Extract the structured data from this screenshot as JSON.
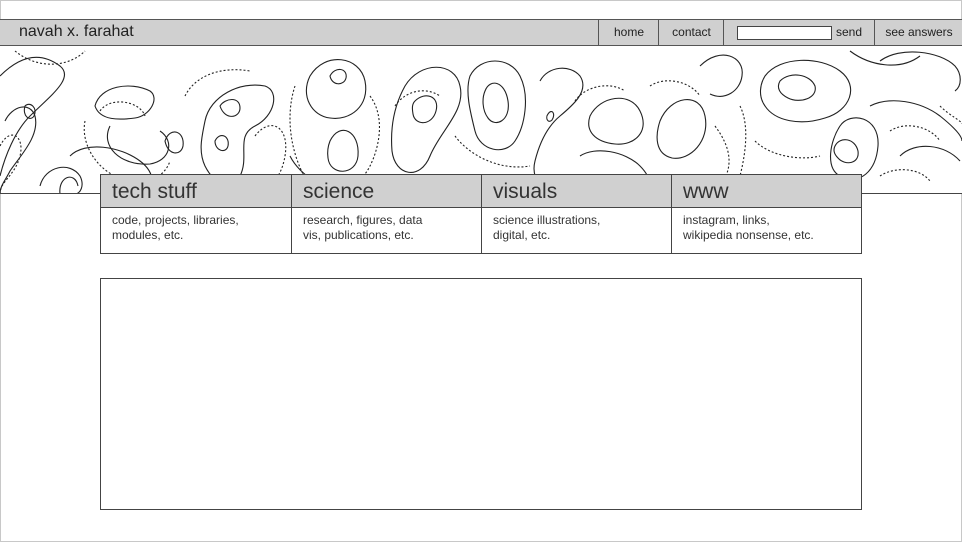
{
  "header": {
    "site_title": "navah x. farahat",
    "nav": {
      "home": "home",
      "contact": "contact",
      "send": "send",
      "see_answers": "see answers"
    },
    "search": {
      "value": "",
      "placeholder": ""
    }
  },
  "banner": {
    "icon": "topographic-contour-map"
  },
  "categories": [
    {
      "title": "tech stuff",
      "description": "code, projects, libraries,\nmodules, etc."
    },
    {
      "title": "science",
      "description": "research, figures, data\nvis, publications, etc."
    },
    {
      "title": "visuals",
      "description": "science illustrations,\ndigital, etc."
    },
    {
      "title": "www",
      "description": "instagram, links,\nwikipedia nonsense, etc."
    }
  ],
  "colors": {
    "header_bg": "#d0d0d0",
    "border": "#444444",
    "background": "#ffffff"
  }
}
